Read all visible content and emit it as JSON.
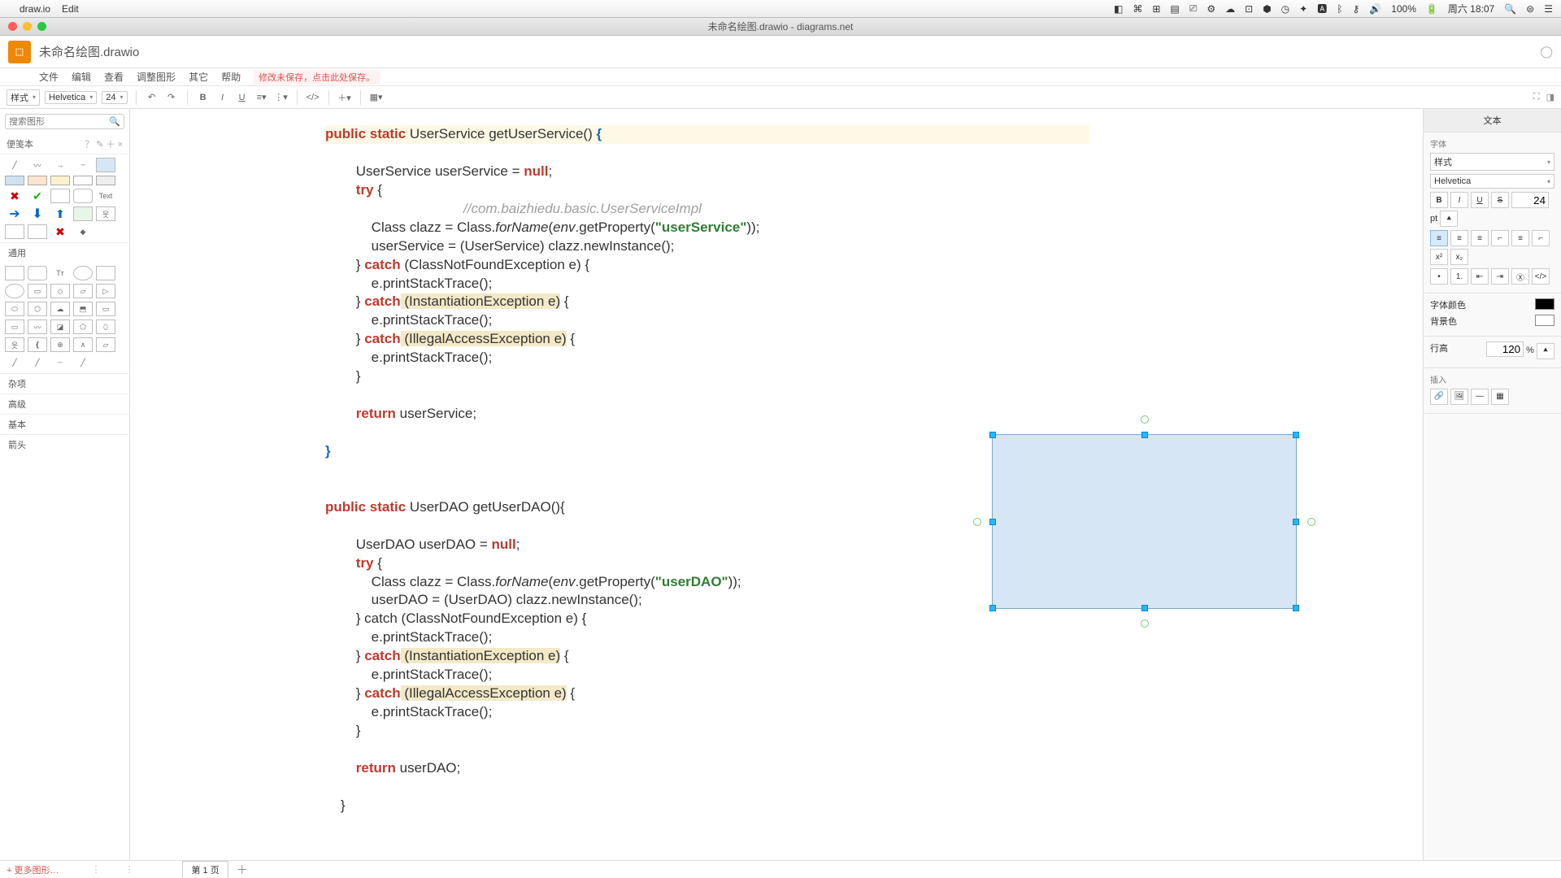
{
  "mac": {
    "app": "draw.io",
    "edit": "Edit",
    "clock": "周六 18:07",
    "battery": "100%"
  },
  "window": {
    "title": "未命名绘图.drawio - diagrams.net"
  },
  "header": {
    "doc_title": "未命名绘图.drawio"
  },
  "menu": {
    "file": "文件",
    "edit": "编辑",
    "view": "查看",
    "arrange": "调整图形",
    "extras": "其它",
    "help": "帮助",
    "unsaved": "修改未保存，点击此处保存。"
  },
  "toolbar": {
    "style": "样式",
    "font": "Helvetica",
    "size": "24"
  },
  "search": {
    "placeholder": "搜索图形"
  },
  "palette": {
    "scratch": "便笺本",
    "text_label": "Text",
    "cat_general": "通用",
    "cat_misc": "杂项",
    "cat_advanced": "高级",
    "cat_basic": "基本",
    "cat_arrow": "箭头"
  },
  "right": {
    "tab": "文本",
    "font_label": "字体",
    "style_option": "样式",
    "font_name": "Helvetica",
    "size_value": "24",
    "size_unit": "pt",
    "color_label": "字体颜色",
    "bg_label": "背景色",
    "lineheight_label": "行高",
    "lineheight_value": "120",
    "lineheight_unit": "%",
    "insert_label": "插入"
  },
  "footer": {
    "more_shapes": "+ 更多图形…",
    "page": "第 1 页"
  },
  "code": {
    "l1a": "public static",
    "l1b": " UserService getUserService() ",
    "l1c": "{",
    "l2": "        UserService userService = ",
    "l2n": "null",
    "l2e": ";",
    "l3": "        try",
    "l3b": " {",
    "l4": "                                    //com.baizhiedu.basic.UserServiceImpl",
    "l5a": "            Class clazz = Class.",
    "l5f": "forName",
    "l5b": "(",
    "l5e": "env",
    "l5c": ".getProperty(",
    "l5s": "\"userService\"",
    "l5d": "));",
    "l6": "            userService = (UserService) clazz.newInstance();",
    "l7a": "        } ",
    "l7c": "catch",
    "l7b": " (ClassNotFoundException e) {",
    "l8": "            e.printStackTrace();",
    "l9a": "        } ",
    "l9c": "catch",
    "l9b": " (InstantiationException e)",
    "l9d": " {",
    "l10": "            e.printStackTrace();",
    "l11a": "        } ",
    "l11c": "catch",
    "l11b": " (IllegalAccessException e)",
    "l11d": " {",
    "l12": "            e.printStackTrace();",
    "l13": "        }",
    "l14a": "        return ",
    "l14b": "userService;",
    "l15": "}",
    "m1a": "public static",
    "m1b": " UserDAO getUserDAO(){",
    "m2a": "        UserDAO userDAO = ",
    "m2n": "null",
    "m2e": ";",
    "m3": "        try",
    "m3b": " {",
    "m4a": "            Class clazz = Class.",
    "m4f": "forName",
    "m4b": "(",
    "m4e": "env",
    "m4c": ".getProperty(",
    "m4s": "\"userDAO\"",
    "m4d": "));",
    "m5": "            userDAO = (UserDAO) clazz.newInstance();",
    "m6a": "        } catch (ClassNotFoundException e) {",
    "m7": "            e.printStackTrace();",
    "m8a": "        } ",
    "m8c": "catch",
    "m8b": " (InstantiationException e)",
    "m8d": " {",
    "m9": "            e.printStackTrace();",
    "m10a": "        } ",
    "m10c": "catch",
    "m10b": " (IllegalAccessException e)",
    "m10d": " {",
    "m11": "            e.printStackTrace();",
    "m12": "        }",
    "m13a": "        return ",
    "m13b": "userDAO;",
    "m14": "    }"
  }
}
